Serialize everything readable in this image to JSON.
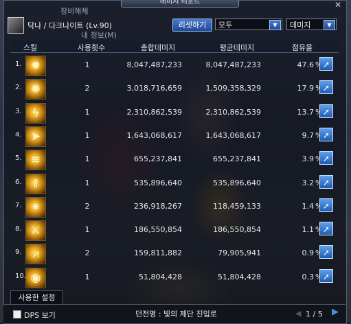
{
  "window": {
    "title": "데미지 리포트",
    "close_glyph": "✕"
  },
  "background_text": [
    "장비해체",
    "내 정보(M)"
  ],
  "character": {
    "name": "닥나 / 다크나이트 (Lv.90)"
  },
  "controls": {
    "reset_label": "리셋하기",
    "target_select": {
      "value": "모두"
    },
    "mode_select": {
      "value": "데미지"
    }
  },
  "table": {
    "headers": [
      "스킬",
      "사용횟수",
      "총합데미지",
      "평균데미지",
      "점유율"
    ],
    "rows": [
      {
        "rank": "1.",
        "uses": "1",
        "total": "8,047,487,233",
        "avg": "8,047,487,233",
        "share": "47.6",
        "icon": "flame-burst-icon"
      },
      {
        "rank": "2.",
        "uses": "2",
        "total": "3,018,716,659",
        "avg": "1,509,358,329",
        "share": "17.9",
        "icon": "dark-sigil-icon"
      },
      {
        "rank": "3.",
        "uses": "1",
        "total": "2,310,862,539",
        "avg": "2,310,862,539",
        "share": "13.7",
        "icon": "lightning-slash-icon"
      },
      {
        "rank": "4.",
        "uses": "1",
        "total": "1,643,068,617",
        "avg": "1,643,068,617",
        "share": "9.7",
        "icon": "spear-thrust-icon"
      },
      {
        "rank": "5.",
        "uses": "1",
        "total": "655,237,841",
        "avg": "655,237,841",
        "share": "3.9",
        "icon": "fire-wave-icon"
      },
      {
        "rank": "6.",
        "uses": "1",
        "total": "535,896,640",
        "avg": "535,896,640",
        "share": "3.2",
        "icon": "pillar-strike-icon"
      },
      {
        "rank": "7.",
        "uses": "2",
        "total": "236,918,267",
        "avg": "118,459,133",
        "share": "1.4",
        "icon": "vortex-icon"
      },
      {
        "rank": "8.",
        "uses": "1",
        "total": "186,550,854",
        "avg": "186,550,854",
        "share": "1.1",
        "icon": "slash-combo-icon"
      },
      {
        "rank": "9.",
        "uses": "2",
        "total": "159,811,882",
        "avg": "79,905,941",
        "share": "0.9",
        "icon": "spike-row-icon"
      },
      {
        "rank": "10.",
        "uses": "1",
        "total": "51,804,428",
        "avg": "51,804,428",
        "share": "0.3",
        "icon": "orb-icon"
      }
    ],
    "percent_sign": "%",
    "export_glyph": "➚"
  },
  "bottom_tab": {
    "label": "사용한 설정"
  },
  "footer": {
    "dps_label": "DPS 보기",
    "dungeon_text": "던전명 : 빛의 제단 진입로",
    "pager": {
      "text": "1 / 5",
      "prev": "◀",
      "next": "▶"
    }
  },
  "colors": {
    "accent": "#2f6cc4",
    "panel": "#0a0c12"
  }
}
